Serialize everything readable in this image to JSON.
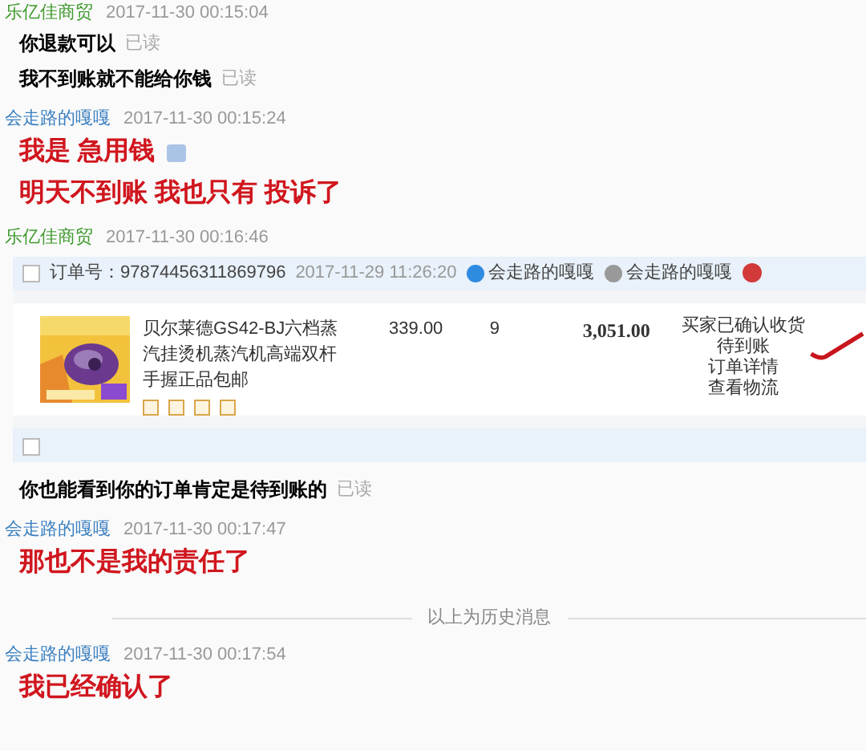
{
  "feed": [
    {
      "kind": "group",
      "sender": "乐亿佳商贸",
      "color": "#3f9a2e",
      "time": "2017-11-30 00:15:04",
      "lines": [
        {
          "kind": "text",
          "text": "你退款可以",
          "read": "已读"
        },
        {
          "kind": "text",
          "text": "我不到账就不能给你钱",
          "read": "已读"
        }
      ]
    },
    {
      "kind": "group",
      "sender": "会走路的嘎嘎",
      "color": "#3a7fc0",
      "time": "2017-11-30 00:15:24",
      "lines": [
        {
          "kind": "shout",
          "text": "我是 急用钱",
          "emoji": true
        },
        {
          "kind": "shout",
          "text": "明天不到账 我也只有 投诉了"
        }
      ]
    },
    {
      "kind": "group",
      "sender": "乐亿佳商贸",
      "color": "#3f9a2e",
      "time": "2017-11-30 00:16:46",
      "lines": [
        {
          "kind": "order",
          "checked": false,
          "next_checked": false,
          "order_no": "订单号：97874456311869796",
          "date": "2017-11-29 11:26:20",
          "buyer_names": [
            "会走路的嘎嘎",
            "会走路的嘎嘎"
          ],
          "product": "贝尔莱德GS42-BJ六档蒸汽挂烫机蒸汽机高端双杆手握正品包邮",
          "price": "339.00",
          "qty": "9",
          "total": "3,051.00",
          "status": "买家已确认收货",
          "links": [
            "待到账",
            "订单详情",
            "查看物流"
          ]
        },
        {
          "kind": "text",
          "text": "你也能看到你的订单肯定是待到账的",
          "read": "已读"
        }
      ]
    },
    {
      "kind": "group",
      "sender": "会走路的嘎嘎",
      "color": "#3a7fc0",
      "time": "2017-11-30 00:17:47",
      "lines": [
        {
          "kind": "shout",
          "text": "那也不是我的责任了"
        }
      ]
    },
    {
      "kind": "divider",
      "text": "以上为历史消息"
    },
    {
      "kind": "group",
      "sender": "会走路的嘎嘎",
      "color": "#3a7fc0",
      "time": "2017-11-30 00:17:54",
      "lines": [
        {
          "kind": "shout",
          "text": "我已经确认了"
        }
      ]
    }
  ]
}
